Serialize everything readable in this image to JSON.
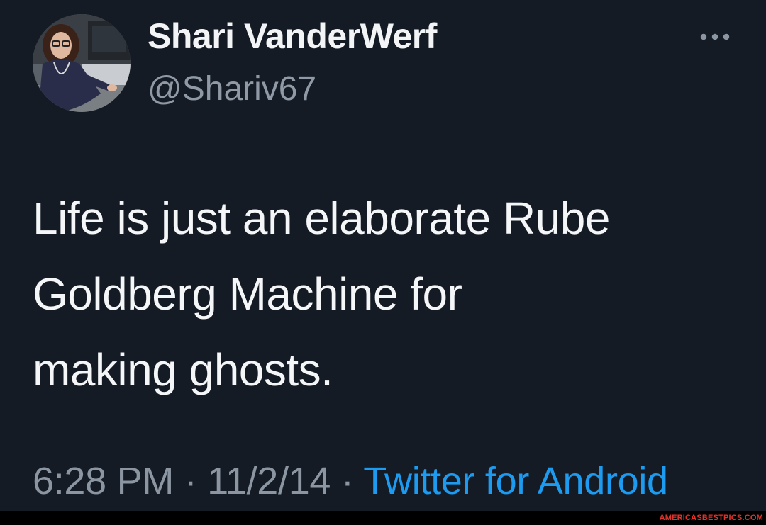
{
  "author": {
    "display_name": "Shari VanderWerf",
    "handle": "@Shariv67",
    "avatar_icon": "profile-photo"
  },
  "more_menu": {
    "icon": "more-horizontal-icon"
  },
  "tweet": {
    "text_lines": [
      "Life is just an elaborate Rube",
      "Goldberg Machine for",
      "making ghosts."
    ]
  },
  "meta": {
    "time": "6:28 PM",
    "separator": " · ",
    "date": "11/2/14",
    "source": "Twitter for Android"
  },
  "watermark": {
    "text": "AMERICASBESTPICS.COM"
  },
  "colors": {
    "background": "#151b24",
    "primary_text": "#f4f6f8",
    "secondary_text": "#8b96a2",
    "link": "#1d9bf0",
    "watermark": "#e4322b"
  }
}
